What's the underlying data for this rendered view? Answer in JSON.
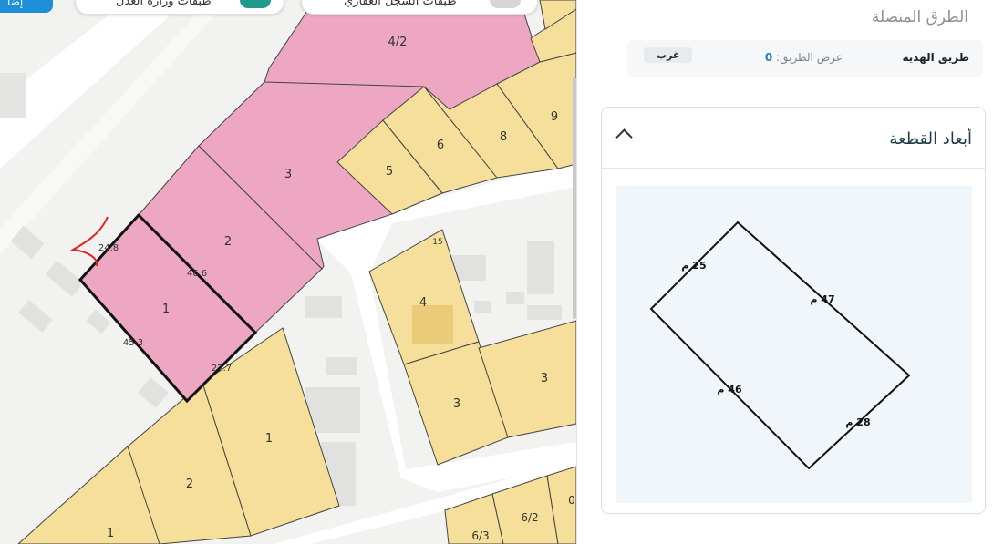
{
  "map": {
    "top_button": "إضا",
    "toggle1_label": "طبقات وزارة العدل",
    "toggle2_label": "طبقات السجل العقاري",
    "colors": {
      "pink": "#eea7c2",
      "yellow": "#f5df9a",
      "road": "#ffffff",
      "bg": "#f2f2f0",
      "building": "#e1e1df",
      "selected_outline": "#111111",
      "annotation": "#e0241f"
    },
    "parcel_labels": [
      "4/2",
      "3",
      "2",
      "1",
      "5",
      "6",
      "8",
      "9",
      "4",
      "3",
      "3",
      "1",
      "2",
      "1",
      "6/3",
      "6/2",
      "0",
      "15"
    ],
    "edge_labels": [
      "24.8",
      "46.6",
      "45.3",
      "27.7"
    ]
  },
  "panel": {
    "connected_roads_title": "الطرق المتصلة",
    "road": {
      "name": "طريق الهدية",
      "width_label": "عرض الطريق:",
      "width_value": "0",
      "direction": "غرب"
    },
    "dimensions_title": "أبعاد القطعة",
    "edges": [
      "25 م",
      "47 م",
      "46 م",
      "28 م"
    ]
  }
}
